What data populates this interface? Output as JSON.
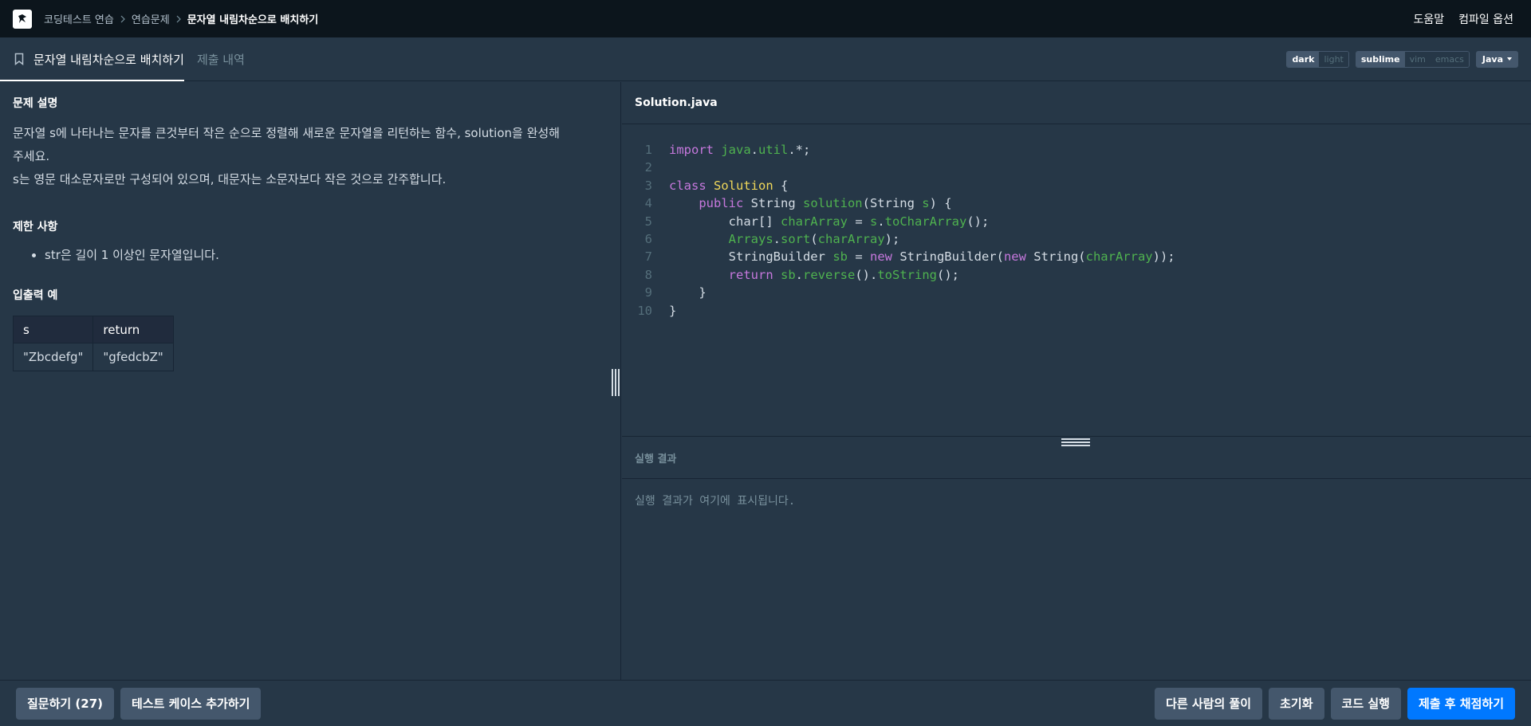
{
  "nav": {
    "breadcrumbs": [
      "코딩테스트 연습",
      "연습문제",
      "문자열 내림차순으로 배치하기"
    ],
    "help": "도움말",
    "compile_options": "컴파일 옵션"
  },
  "tabs": {
    "problem": "문자열 내림차순으로 배치하기",
    "submissions": "제출 내역"
  },
  "editor_options": {
    "theme": [
      "dark",
      "light"
    ],
    "theme_selected": "dark",
    "keymap": [
      "sublime",
      "vim",
      "emacs"
    ],
    "keymap_selected": "sublime",
    "language": "Java"
  },
  "problem": {
    "desc_title": "문제 설명",
    "desc_line1": "문자열 s에 나타나는 문자를 큰것부터 작은 순으로 정렬해 새로운 문자열을 리턴하는 함수, solution을 완성해",
    "desc_line2": "주세요.",
    "desc_line3": "s는 영문 대소문자로만 구성되어 있으며, 대문자는 소문자보다 작은 것으로 간주합니다.",
    "constraints_title": "제한 사항",
    "constraints": [
      "str은 길이 1 이상인 문자열입니다."
    ],
    "io_title": "입출력 예",
    "io_headers": [
      "s",
      "return"
    ],
    "io_rows": [
      [
        "\"Zbcdefg\"",
        "\"gfedcbZ\""
      ]
    ]
  },
  "editor": {
    "filename": "Solution.java",
    "line_numbers": [
      "1",
      "2",
      "3",
      "4",
      "5",
      "6",
      "7",
      "8",
      "9",
      "10"
    ]
  },
  "result": {
    "title": "실행 결과",
    "placeholder": "실행 결과가 여기에 표시됩니다."
  },
  "footer": {
    "ask": "질문하기 (27)",
    "add_testcase": "테스트 케이스 추가하기",
    "others_solutions": "다른 사람의 풀이",
    "reset": "초기화",
    "run": "코드 실행",
    "submit": "제출 후 채점하기"
  },
  "colors": {
    "accent": "#0078ff",
    "bg": "#263747",
    "nav_bg": "#0c151c"
  }
}
